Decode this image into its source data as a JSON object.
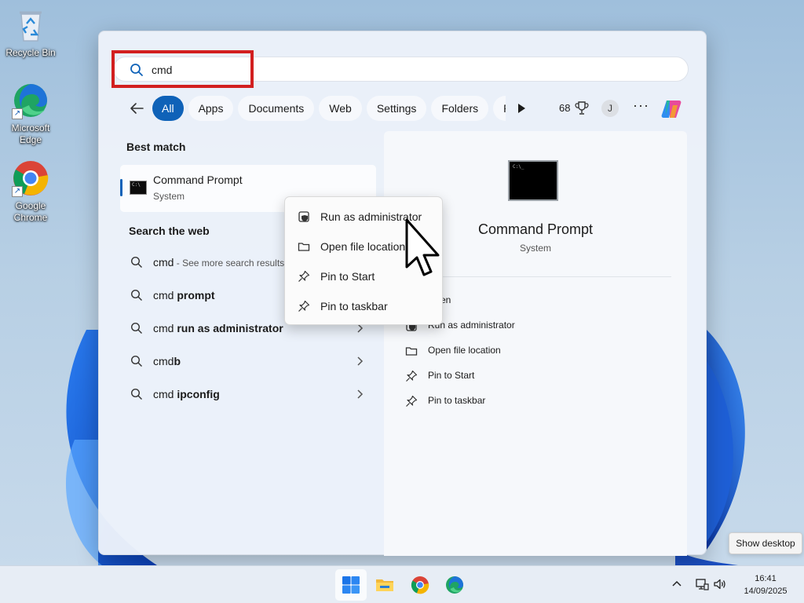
{
  "desktop": {
    "icons": [
      {
        "label": "Recycle Bin"
      },
      {
        "label": "Microsoft Edge"
      },
      {
        "label": "Google Chrome"
      }
    ]
  },
  "search": {
    "query": "cmd",
    "placeholder": ""
  },
  "filters": {
    "tabs": [
      "All",
      "Apps",
      "Documents",
      "Web",
      "Settings",
      "Folders",
      "Pho"
    ],
    "active": "All",
    "points": "68",
    "avatar_initial": "J",
    "more": "···"
  },
  "best_match": {
    "section_title": "Best match",
    "title": "Command Prompt",
    "subtitle": "System"
  },
  "web_search": {
    "section_title": "Search the web",
    "items": [
      {
        "base": "cmd",
        "bold": "",
        "hint": " - See more search results"
      },
      {
        "base": "cmd ",
        "bold": "prompt",
        "hint": ""
      },
      {
        "base": "cmd ",
        "bold": "run as administrator",
        "hint": ""
      },
      {
        "base": "cmd",
        "bold": "b",
        "hint": ""
      },
      {
        "base": "cmd ",
        "bold": "ipconfig",
        "hint": ""
      }
    ]
  },
  "preview": {
    "title": "Command Prompt",
    "subtitle": "System",
    "actions": [
      "Open",
      "Run as administrator",
      "Open file location",
      "Pin to Start",
      "Pin to taskbar"
    ]
  },
  "context_menu": {
    "items": [
      "Run as administrator",
      "Open file location",
      "Pin to Start",
      "Pin to taskbar"
    ]
  },
  "tooltip": "Show desktop",
  "taskbar": {
    "time": "16:41",
    "date": "14/09/2025"
  },
  "colors": {
    "accent": "#0f62b8",
    "highlight": "#d21f1f"
  }
}
